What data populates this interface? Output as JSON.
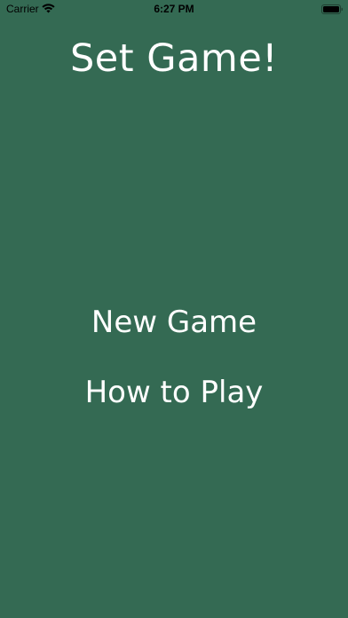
{
  "status_bar": {
    "carrier": "Carrier",
    "time": "6:27 PM",
    "wifi_icon": "wifi-icon",
    "battery_icon": "battery-icon"
  },
  "title": "Set Game!",
  "menu": {
    "new_game": "New Game",
    "how_to_play": "How to Play"
  },
  "colors": {
    "background": "#346a53",
    "text": "#ffffff",
    "status_text": "#000000"
  }
}
